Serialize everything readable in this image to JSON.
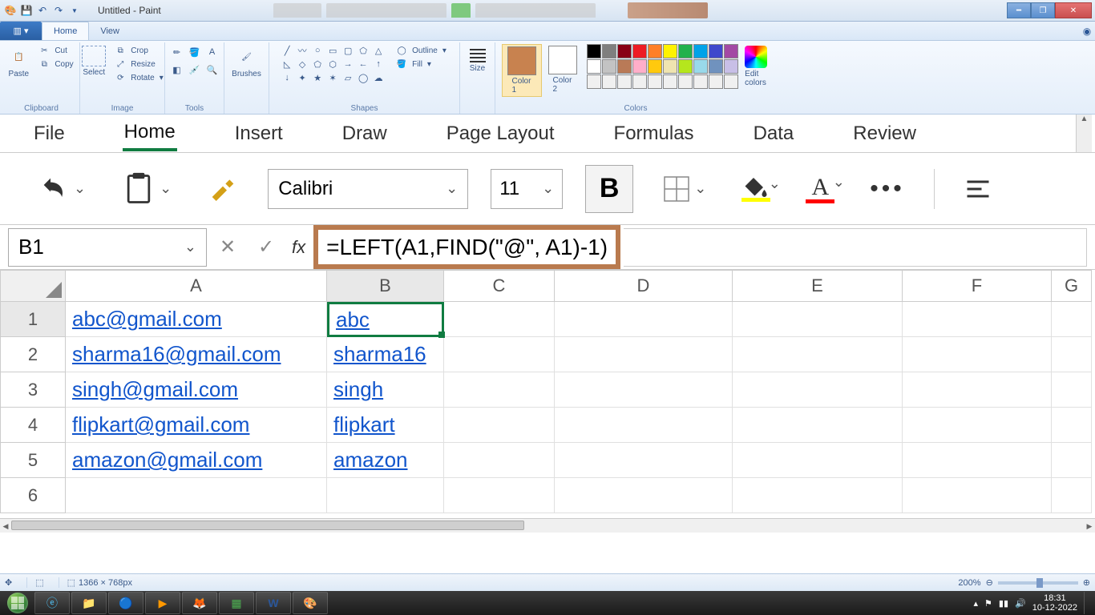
{
  "paint": {
    "title": "Untitled - Paint",
    "tabs": {
      "home": "Home",
      "view": "View"
    },
    "groups": {
      "clipboard": {
        "label": "Clipboard",
        "paste": "Paste",
        "cut": "Cut",
        "copy": "Copy"
      },
      "image": {
        "label": "Image",
        "select": "Select",
        "crop": "Crop",
        "resize": "Resize",
        "rotate": "Rotate"
      },
      "tools": {
        "label": "Tools"
      },
      "shapes": {
        "label": "Shapes",
        "outline": "Outline",
        "fill": "Fill"
      },
      "size": {
        "label": "Size"
      },
      "colors": {
        "label": "Colors",
        "color1": "Color\n1",
        "color2": "Color\n2",
        "edit": "Edit\ncolors"
      }
    },
    "palette": [
      "#000000",
      "#7f7f7f",
      "#880015",
      "#ed1c24",
      "#ff7f27",
      "#fff200",
      "#22b14c",
      "#00a2e8",
      "#3f48cc",
      "#a349a4",
      "#ffffff",
      "#c3c3c3",
      "#b97a57",
      "#ffaec9",
      "#ffc90e",
      "#efe4b0",
      "#b5e61d",
      "#99d9ea",
      "#7092be",
      "#c8bfe7",
      "#f0f0f0",
      "#f0f0f0",
      "#f0f0f0",
      "#f0f0f0",
      "#f0f0f0",
      "#f0f0f0",
      "#f0f0f0",
      "#f0f0f0",
      "#f0f0f0",
      "#f0f0f0"
    ],
    "current_color1": "#c8824f",
    "current_color2": "#ffffff",
    "status": {
      "canvas_size": "1366 × 768px",
      "zoom": "200%"
    }
  },
  "excel": {
    "tabs": [
      "File",
      "Home",
      "Insert",
      "Draw",
      "Page Layout",
      "Formulas",
      "Data",
      "Review"
    ],
    "active_tab": "Home",
    "font": {
      "name": "Calibri",
      "size": "11"
    },
    "name_box": "B1",
    "formula": "=LEFT(A1,FIND(\"@\", A1)-1)",
    "columns": [
      "A",
      "B",
      "C",
      "D",
      "E",
      "F",
      "G"
    ],
    "rows": [
      {
        "n": "1",
        "A": "abc@gmail.com",
        "B": "abc"
      },
      {
        "n": "2",
        "A": "sharma16@gmail.com",
        "B": "sharma16"
      },
      {
        "n": "3",
        "A": "singh@gmail.com",
        "B": "singh"
      },
      {
        "n": "4",
        "A": "flipkart@gmail.com",
        "B": "flipkart"
      },
      {
        "n": "5",
        "A": "amazon@gmail.com",
        "B": "amazon"
      },
      {
        "n": "6",
        "A": "",
        "B": ""
      }
    ]
  },
  "taskbar": {
    "time": "18:31",
    "date": "10-12-2022"
  }
}
